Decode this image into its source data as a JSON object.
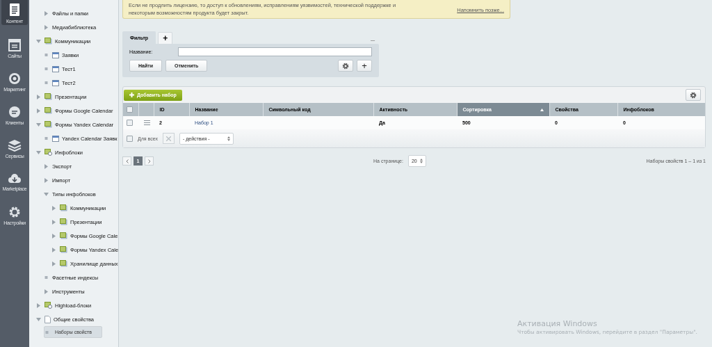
{
  "nav": [
    {
      "label": "Контент",
      "selected": true
    },
    {
      "label": "Сайты",
      "selected": false
    },
    {
      "label": "Маркетинг",
      "selected": false
    },
    {
      "label": "Клиенты",
      "selected": false
    },
    {
      "label": "Сервисы",
      "selected": false
    },
    {
      "label": "Marketplace",
      "selected": false
    },
    {
      "label": "Настройки",
      "selected": false
    }
  ],
  "tree": {
    "continued_children": [
      {
        "label": "Файлы и папки",
        "expanded": false,
        "selected": false
      },
      {
        "label": "Медиабиблиотека",
        "expanded": false,
        "selected": false
      }
    ],
    "items": [
      {
        "label": "Коммуникации",
        "kind": "folder",
        "expanded": true,
        "selected": false,
        "children": [
          {
            "label": "Заявки",
            "kind": "table",
            "selected": false
          },
          {
            "label": "Тест1",
            "kind": "table",
            "selected": false
          },
          {
            "label": "Тест2",
            "kind": "table",
            "selected": false
          }
        ]
      },
      {
        "label": "Презентации",
        "kind": "folder",
        "expanded": false,
        "selected": false
      },
      {
        "label": "Формы Google Calendar",
        "kind": "folder",
        "expanded": false,
        "selected": false
      },
      {
        "label": "Формы Yandex Calendar",
        "kind": "folder",
        "expanded": true,
        "selected": false,
        "children": [
          {
            "label": "Yandex Calendar Заявк",
            "kind": "table",
            "selected": false
          }
        ]
      },
      {
        "label": "Инфоблоки",
        "kind": "infoblock",
        "expanded": true,
        "selected": false,
        "children": [
          {
            "label": "Экспорт",
            "expanded": false,
            "selected": false
          },
          {
            "label": "Импорт",
            "expanded": false,
            "selected": false
          },
          {
            "label": "Типы инфоблоков",
            "expanded": true,
            "selected": false,
            "children": [
              {
                "label": "Коммуникации",
                "kind": "folder",
                "expanded": false,
                "selected": false
              },
              {
                "label": "Презентации",
                "kind": "folder",
                "expanded": false,
                "selected": false
              },
              {
                "label": "Формы Google Cale",
                "kind": "folder",
                "expanded": false,
                "selected": false
              },
              {
                "label": "Формы Yandex Cale",
                "kind": "folder",
                "expanded": false,
                "selected": false
              },
              {
                "label": "Хранилище данных",
                "kind": "folder",
                "expanded": false,
                "selected": false
              }
            ]
          },
          {
            "label": "Фасетные индексы",
            "selected": false
          },
          {
            "label": "Инструменты",
            "expanded": false,
            "selected": false
          }
        ]
      },
      {
        "label": "Highload-блоки",
        "kind": "infoblock",
        "expanded": false,
        "selected": false
      },
      {
        "label": "Общие свойства",
        "kind": "page",
        "expanded": true,
        "selected": false,
        "children": [
          {
            "label": "Наборы свойств",
            "selected": true
          }
        ]
      }
    ]
  },
  "license_notice": {
    "text": "Если не продлить лицензию, то доступ к обновлениям, исправлениям уязвимостей, технической поддержке и некоторым возможностям продукта будет закрыт.",
    "remind_link": "Напомнить позже..."
  },
  "filter": {
    "tabs": [
      {
        "label": "Фильтр",
        "selected": true
      }
    ],
    "add_tab": "+",
    "minimize": "–",
    "field_label": "Название:",
    "find_button": "Найти",
    "cancel_button": "Отменить",
    "add_button": "+"
  },
  "grid": {
    "add_button": "Добавить набор",
    "columns": [
      {
        "label": "ID",
        "sorted": false
      },
      {
        "label": "Название",
        "sorted": false
      },
      {
        "label": "Символьный код",
        "sorted": false
      },
      {
        "label": "Активность",
        "sorted": false
      },
      {
        "label": "Сортировка",
        "sorted": true
      },
      {
        "label": "Свойства",
        "sorted": false
      },
      {
        "label": "Инфоблоков",
        "sorted": false
      }
    ],
    "select_all_checked": false,
    "rows": [
      {
        "checked": false,
        "cells": [
          "2",
          "Набор 1",
          "",
          "Да",
          "500",
          "0",
          "0"
        ]
      }
    ],
    "footer": {
      "checked": false,
      "for_all_label": "Для всех",
      "actions_placeholder": "- действия -"
    }
  },
  "pagination": {
    "pages": [
      {
        "label": "1",
        "selected": true
      }
    ],
    "per_page_label": "На странице:",
    "per_page": "20",
    "summary": "Наборы свойств 1 – 1 из 1"
  },
  "os_notice": {
    "title": "Активация Windows",
    "text": "Чтобы активировать Windows, перейдите в раздел \"Параметры\"."
  }
}
